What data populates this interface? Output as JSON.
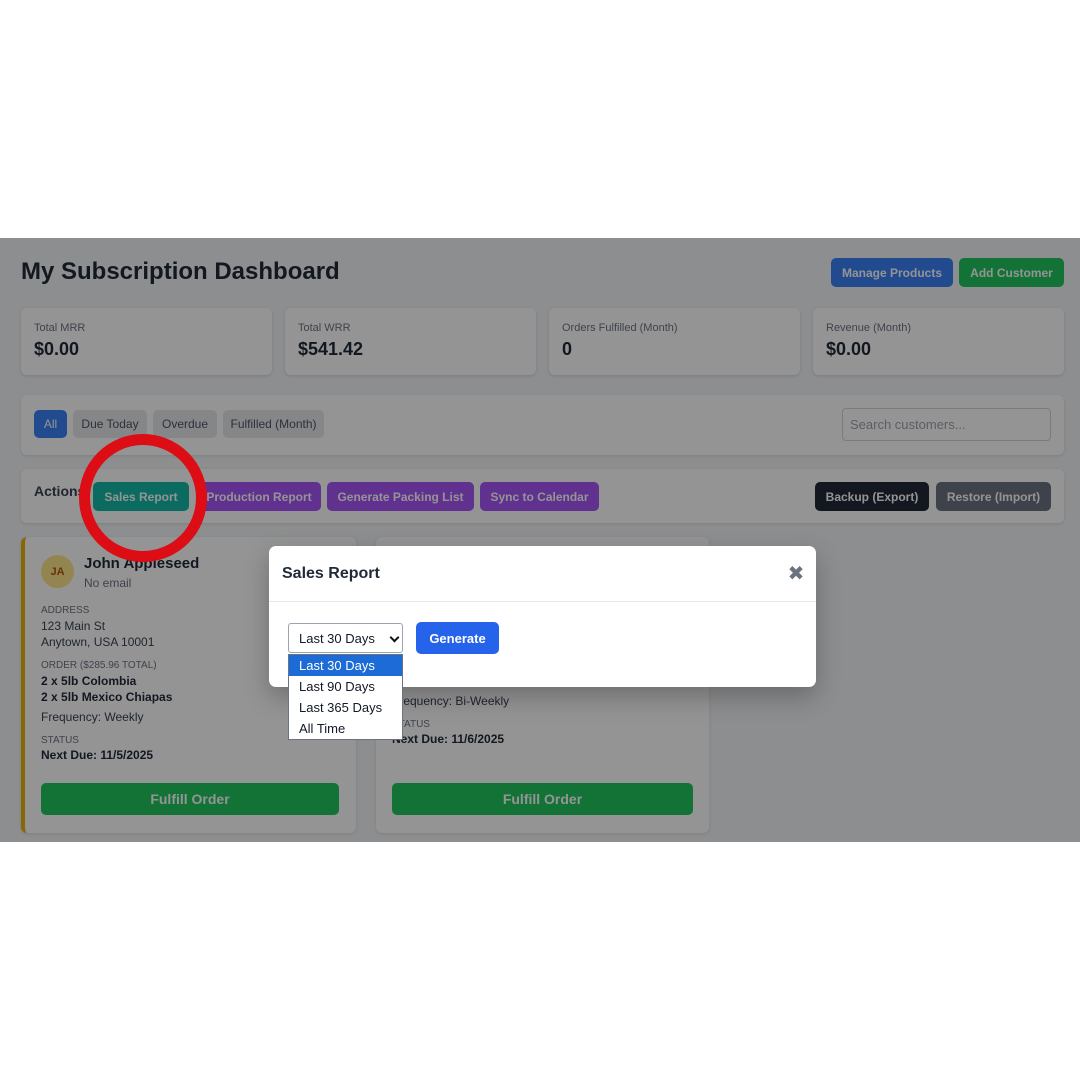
{
  "dashboard": {
    "title": "My Subscription Dashboard",
    "manage_products": "Manage Products",
    "add_customer": "Add Customer"
  },
  "stats": [
    {
      "label": "Total MRR",
      "value": "$0.00"
    },
    {
      "label": "Total WRR",
      "value": "$541.42"
    },
    {
      "label": "Orders Fulfilled (Month)",
      "value": "0"
    },
    {
      "label": "Revenue (Month)",
      "value": "$0.00"
    }
  ],
  "filters": {
    "all": "All",
    "due_today": "Due Today",
    "overdue": "Overdue",
    "fulfilled": "Fulfilled (Month)",
    "search_placeholder": "Search customers..."
  },
  "actions": {
    "label": "Actions:",
    "sales_report": "Sales Report",
    "production_report": "Production Report",
    "packing_list": "Generate Packing List",
    "sync_calendar": "Sync to Calendar",
    "backup": "Backup (Export)",
    "restore": "Restore (Import)"
  },
  "customers": [
    {
      "initials": "JA",
      "name": "John Appleseed",
      "email": "No email",
      "address_label": "Address",
      "address_line1": "123 Main St",
      "address_line2": "Anytown, USA 10001",
      "order_label": "Order ($285.96 Total)",
      "item1": "2 x 5lb Colombia",
      "item2": "2 x 5lb Mexico Chiapas",
      "frequency": "Frequency: Weekly",
      "status_label": "Status",
      "next_due": "Next Due: 11/5/2025",
      "fulfill": "Fulfill Order"
    },
    {
      "frequency": "Frequency: Bi-Weekly",
      "status_label": "Status",
      "next_due": "Next Due: 11/6/2025",
      "fulfill": "Fulfill Order"
    }
  ],
  "modal": {
    "title": "Sales Report",
    "close": "✖",
    "selected": "Last 30 Days",
    "generate": "Generate",
    "options": [
      "Last 30 Days",
      "Last 90 Days",
      "Last 365 Days",
      "All Time"
    ]
  },
  "colors": {
    "accent_blue": "#2563eb",
    "highlight_ring": "#dc0d14",
    "sales_report_teal": "#14b8a6",
    "purple": "#a855f7"
  }
}
